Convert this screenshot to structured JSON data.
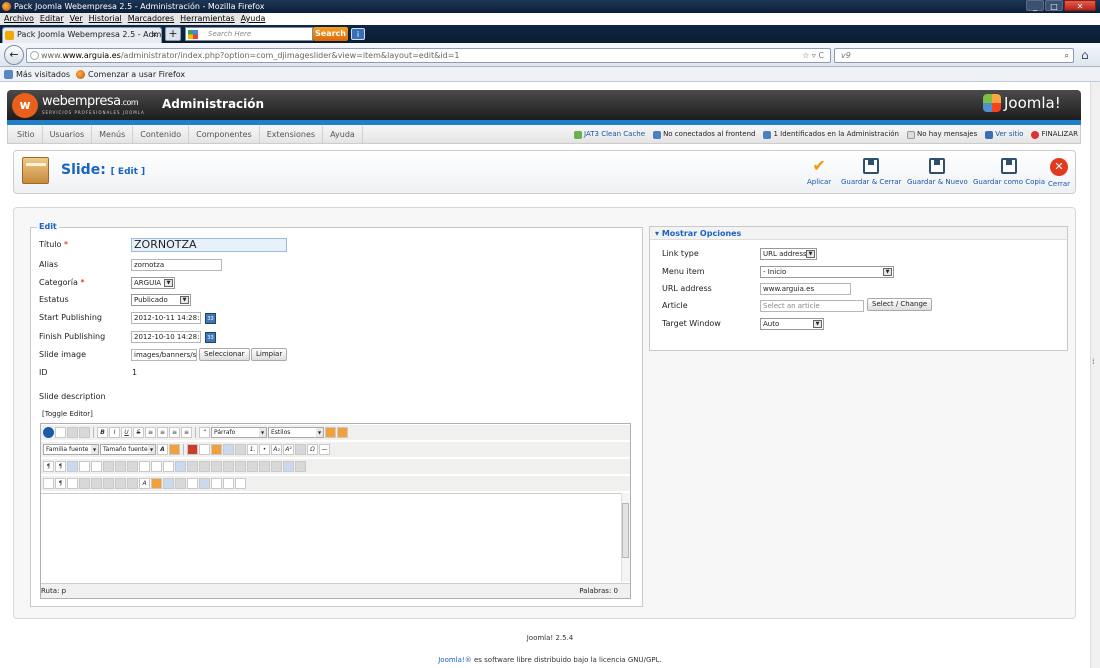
{
  "browser": {
    "window_title": "Pack Joomla Webempresa 2.5 - Administración - Mozilla Firefox",
    "menu": [
      "Archivo",
      "Editar",
      "Ver",
      "Historial",
      "Marcadores",
      "Herramientas",
      "Ayuda"
    ],
    "tab_title": "Pack Joomla Webempresa 2.5 - Adminis...",
    "tab_close": "×",
    "new_tab": "+",
    "toolbar_search_placeholder": "Search Here",
    "toolbar_search_button": "Search",
    "url_domain": "www.arguia.es",
    "url_path": "/administrator/index.php?option=com_djimageslider&view=item&layout=edit&id=1",
    "url_prefix": "www.",
    "search_engine_text": "v9",
    "bookmarks": [
      "Más visitados",
      "Comenzar a usar Firefox"
    ]
  },
  "admin": {
    "brand": "webempresa",
    "brand_suffix": ".com",
    "brand_tagline": "SERVICIOS PROFESIONALES JOOMLA",
    "title": "Administración",
    "joomla_logo": "Joomla!",
    "menu": [
      "Sitio",
      "Usuarios",
      "Menús",
      "Contenido",
      "Componentes",
      "Extensiones",
      "Ayuda"
    ],
    "status": {
      "cache": "JAT3 Clean Cache",
      "frontend": "No conectados al frontend",
      "backend": "1 Identificados en la Administración",
      "messages": "No hay mensajes",
      "view_site": "Ver sitio",
      "logout": "FINALIZAR"
    }
  },
  "toolbar": {
    "title": "Slide:",
    "subtitle": "[ Edit ]",
    "buttons": {
      "apply": "Aplicar",
      "save_close": "Guardar & Cerrar",
      "save_new": "Guardar & Nuevo",
      "save_copy": "Guardar como Copia",
      "close": "Cerrar"
    }
  },
  "edit": {
    "legend": "Edit",
    "labels": {
      "title": "Título",
      "alias": "Alias",
      "category": "Categoría",
      "status": "Estatus",
      "start": "Start Publishing",
      "finish": "Finish Publishing",
      "image": "Slide image",
      "id": "ID",
      "description": "Slide description"
    },
    "required_mark": "*",
    "values": {
      "title": "ZORNOTZA",
      "alias": "zornotza",
      "category": "ARGUIA",
      "status": "Publicado",
      "start": "2012-10-11 14:28:54",
      "finish": "2012-10-10 14:28:59",
      "image": "images/banners/shoj",
      "id": "1"
    },
    "select_button": "Seleccionar",
    "clear_button": "Limpiar",
    "calendar_icon": "33",
    "toggle_editor": "[Toggle Editor]",
    "editor": {
      "format": "Párrafo",
      "styles": "Estilos",
      "font_family": "Familia fuente",
      "font_size": "Tamaño fuente",
      "path": "Ruta:  p",
      "words": "Palabras: 0"
    }
  },
  "options": {
    "legend": "Mostrar Opciones",
    "labels": {
      "link_type": "Link type",
      "menu_item": "Menu item",
      "url": "URL address",
      "article": "Article",
      "target": "Target Window"
    },
    "values": {
      "link_type": "URL address",
      "menu_item": "- Inicio",
      "url": "www.arguia.es",
      "article_placeholder": "Select an article",
      "target": "Auto"
    },
    "select_change": "Select / Change"
  },
  "footer": {
    "version": "Joomla! 2.5.4",
    "license_link": "Joomla!®",
    "license_text": " es software libre distribuido bajo la licencia GNU/GPL."
  }
}
